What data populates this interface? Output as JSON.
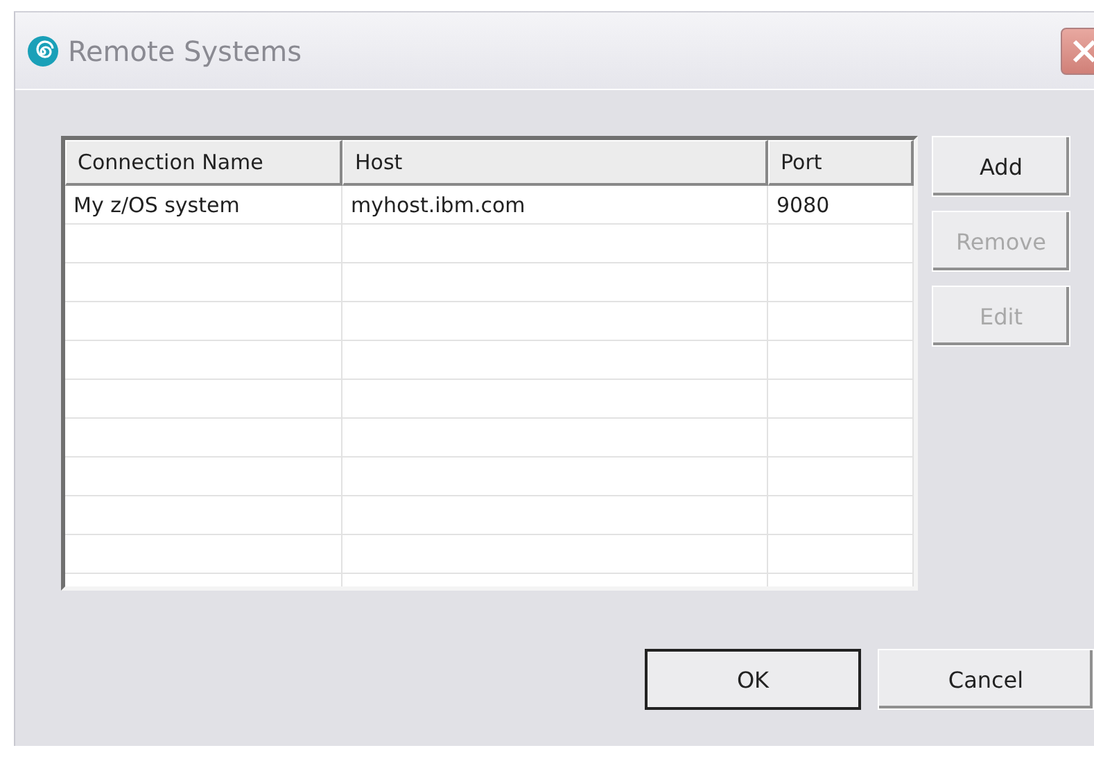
{
  "window": {
    "title": "Remote Systems"
  },
  "table": {
    "columns": [
      "Connection Name",
      "Host",
      "Port"
    ],
    "rows": [
      [
        "My z/OS system",
        "myhost.ibm.com",
        "9080"
      ]
    ]
  },
  "side_buttons": [
    {
      "label": "Add",
      "disabled": false
    },
    {
      "label": "Remove",
      "disabled": true
    },
    {
      "label": "Edit",
      "disabled": true
    }
  ],
  "footer_buttons": [
    {
      "label": "OK",
      "default": true
    },
    {
      "label": "Cancel",
      "default": false
    }
  ]
}
